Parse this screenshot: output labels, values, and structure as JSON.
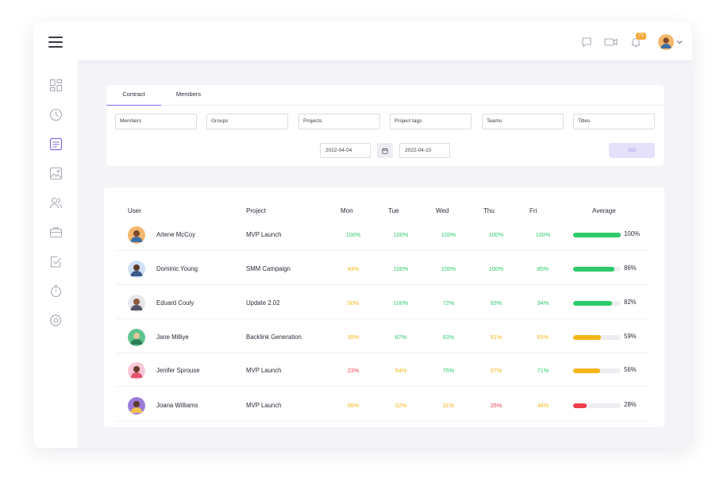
{
  "topbar": {
    "notification_count": "71"
  },
  "tabs": [
    {
      "label": "Contract",
      "active": true
    },
    {
      "label": "Members",
      "active": false
    }
  ],
  "filters": [
    "Members",
    "Groups",
    "Projects",
    "Project tags",
    "Teams",
    "Titles"
  ],
  "dates": {
    "start": "2022-04-04",
    "end": "2022-04-10"
  },
  "go_label": "GO",
  "table": {
    "headers": {
      "user": "User",
      "project": "Project",
      "mon": "Mon",
      "tue": "Tue",
      "wed": "Wed",
      "thu": "Thu",
      "fri": "Fri",
      "average": "Average"
    },
    "rows": [
      {
        "user": "Arlene McCoy",
        "project": "MVP Launch",
        "mon": "100%",
        "tue": "100%",
        "wed": "100%",
        "thu": "100%",
        "fri": "100%",
        "average": "100%",
        "avg_value": 100
      },
      {
        "user": "Dominic Young",
        "project": "SMM Campaign",
        "mon": "43%",
        "tue": "100%",
        "wed": "100%",
        "thu": "100%",
        "fri": "85%",
        "average": "86%",
        "avg_value": 86
      },
      {
        "user": "Eduard Couly",
        "project": "Update 2.02",
        "mon": "50%",
        "tue": "100%",
        "wed": "72%",
        "thu": "93%",
        "fri": "94%",
        "average": "82%",
        "avg_value": 82
      },
      {
        "user": "Jane Milliye",
        "project": "Backlink Generation",
        "mon": "39%",
        "tue": "87%",
        "wed": "63%",
        "thu": "51%",
        "fri": "55%",
        "average": "59%",
        "avg_value": 59
      },
      {
        "user": "Jenifer Sprouse",
        "project": "MVP Launch",
        "mon": "23%",
        "tue": "54%",
        "wed": "75%",
        "thu": "57%",
        "fri": "71%",
        "average": "56%",
        "avg_value": 56
      },
      {
        "user": "Joana Williams",
        "project": "MVP Launch",
        "mon": "56%",
        "tue": "32%",
        "wed": "31%",
        "thu": "26%",
        "fri": "48%",
        "average": "28%",
        "avg_value": 28
      }
    ]
  },
  "colors": {
    "green": "#2ecb6b",
    "yellow": "#f5b616",
    "red": "#ec3f4d",
    "accent": "#7b6cf6",
    "icon_gray": "#a9a9b8"
  },
  "sidebar_icons": [
    "dashboard-icon",
    "clock-icon",
    "timesheet-icon",
    "image-icon",
    "people-icon",
    "briefcase-icon",
    "task-check-icon",
    "stopwatch-icon",
    "settings-icon"
  ]
}
